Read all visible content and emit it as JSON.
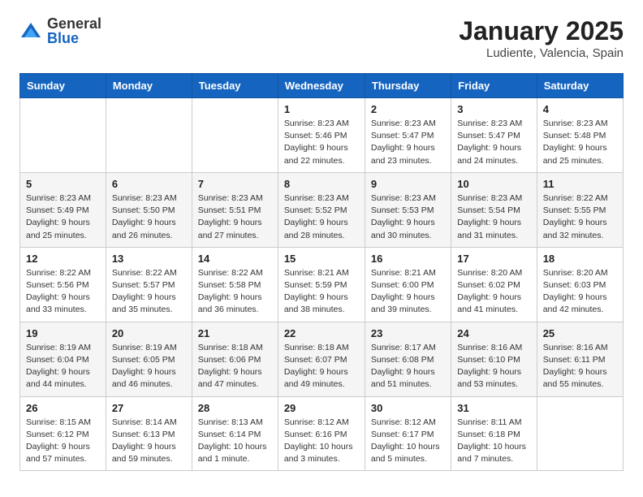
{
  "logo": {
    "general": "General",
    "blue": "Blue"
  },
  "header": {
    "title": "January 2025",
    "location": "Ludiente, Valencia, Spain"
  },
  "weekdays": [
    "Sunday",
    "Monday",
    "Tuesday",
    "Wednesday",
    "Thursday",
    "Friday",
    "Saturday"
  ],
  "weeks": [
    [
      {
        "day": "",
        "info": ""
      },
      {
        "day": "",
        "info": ""
      },
      {
        "day": "",
        "info": ""
      },
      {
        "day": "1",
        "info": "Sunrise: 8:23 AM\nSunset: 5:46 PM\nDaylight: 9 hours\nand 22 minutes."
      },
      {
        "day": "2",
        "info": "Sunrise: 8:23 AM\nSunset: 5:47 PM\nDaylight: 9 hours\nand 23 minutes."
      },
      {
        "day": "3",
        "info": "Sunrise: 8:23 AM\nSunset: 5:47 PM\nDaylight: 9 hours\nand 24 minutes."
      },
      {
        "day": "4",
        "info": "Sunrise: 8:23 AM\nSunset: 5:48 PM\nDaylight: 9 hours\nand 25 minutes."
      }
    ],
    [
      {
        "day": "5",
        "info": "Sunrise: 8:23 AM\nSunset: 5:49 PM\nDaylight: 9 hours\nand 25 minutes."
      },
      {
        "day": "6",
        "info": "Sunrise: 8:23 AM\nSunset: 5:50 PM\nDaylight: 9 hours\nand 26 minutes."
      },
      {
        "day": "7",
        "info": "Sunrise: 8:23 AM\nSunset: 5:51 PM\nDaylight: 9 hours\nand 27 minutes."
      },
      {
        "day": "8",
        "info": "Sunrise: 8:23 AM\nSunset: 5:52 PM\nDaylight: 9 hours\nand 28 minutes."
      },
      {
        "day": "9",
        "info": "Sunrise: 8:23 AM\nSunset: 5:53 PM\nDaylight: 9 hours\nand 30 minutes."
      },
      {
        "day": "10",
        "info": "Sunrise: 8:23 AM\nSunset: 5:54 PM\nDaylight: 9 hours\nand 31 minutes."
      },
      {
        "day": "11",
        "info": "Sunrise: 8:22 AM\nSunset: 5:55 PM\nDaylight: 9 hours\nand 32 minutes."
      }
    ],
    [
      {
        "day": "12",
        "info": "Sunrise: 8:22 AM\nSunset: 5:56 PM\nDaylight: 9 hours\nand 33 minutes."
      },
      {
        "day": "13",
        "info": "Sunrise: 8:22 AM\nSunset: 5:57 PM\nDaylight: 9 hours\nand 35 minutes."
      },
      {
        "day": "14",
        "info": "Sunrise: 8:22 AM\nSunset: 5:58 PM\nDaylight: 9 hours\nand 36 minutes."
      },
      {
        "day": "15",
        "info": "Sunrise: 8:21 AM\nSunset: 5:59 PM\nDaylight: 9 hours\nand 38 minutes."
      },
      {
        "day": "16",
        "info": "Sunrise: 8:21 AM\nSunset: 6:00 PM\nDaylight: 9 hours\nand 39 minutes."
      },
      {
        "day": "17",
        "info": "Sunrise: 8:20 AM\nSunset: 6:02 PM\nDaylight: 9 hours\nand 41 minutes."
      },
      {
        "day": "18",
        "info": "Sunrise: 8:20 AM\nSunset: 6:03 PM\nDaylight: 9 hours\nand 42 minutes."
      }
    ],
    [
      {
        "day": "19",
        "info": "Sunrise: 8:19 AM\nSunset: 6:04 PM\nDaylight: 9 hours\nand 44 minutes."
      },
      {
        "day": "20",
        "info": "Sunrise: 8:19 AM\nSunset: 6:05 PM\nDaylight: 9 hours\nand 46 minutes."
      },
      {
        "day": "21",
        "info": "Sunrise: 8:18 AM\nSunset: 6:06 PM\nDaylight: 9 hours\nand 47 minutes."
      },
      {
        "day": "22",
        "info": "Sunrise: 8:18 AM\nSunset: 6:07 PM\nDaylight: 9 hours\nand 49 minutes."
      },
      {
        "day": "23",
        "info": "Sunrise: 8:17 AM\nSunset: 6:08 PM\nDaylight: 9 hours\nand 51 minutes."
      },
      {
        "day": "24",
        "info": "Sunrise: 8:16 AM\nSunset: 6:10 PM\nDaylight: 9 hours\nand 53 minutes."
      },
      {
        "day": "25",
        "info": "Sunrise: 8:16 AM\nSunset: 6:11 PM\nDaylight: 9 hours\nand 55 minutes."
      }
    ],
    [
      {
        "day": "26",
        "info": "Sunrise: 8:15 AM\nSunset: 6:12 PM\nDaylight: 9 hours\nand 57 minutes."
      },
      {
        "day": "27",
        "info": "Sunrise: 8:14 AM\nSunset: 6:13 PM\nDaylight: 9 hours\nand 59 minutes."
      },
      {
        "day": "28",
        "info": "Sunrise: 8:13 AM\nSunset: 6:14 PM\nDaylight: 10 hours\nand 1 minute."
      },
      {
        "day": "29",
        "info": "Sunrise: 8:12 AM\nSunset: 6:16 PM\nDaylight: 10 hours\nand 3 minutes."
      },
      {
        "day": "30",
        "info": "Sunrise: 8:12 AM\nSunset: 6:17 PM\nDaylight: 10 hours\nand 5 minutes."
      },
      {
        "day": "31",
        "info": "Sunrise: 8:11 AM\nSunset: 6:18 PM\nDaylight: 10 hours\nand 7 minutes."
      },
      {
        "day": "",
        "info": ""
      }
    ]
  ]
}
